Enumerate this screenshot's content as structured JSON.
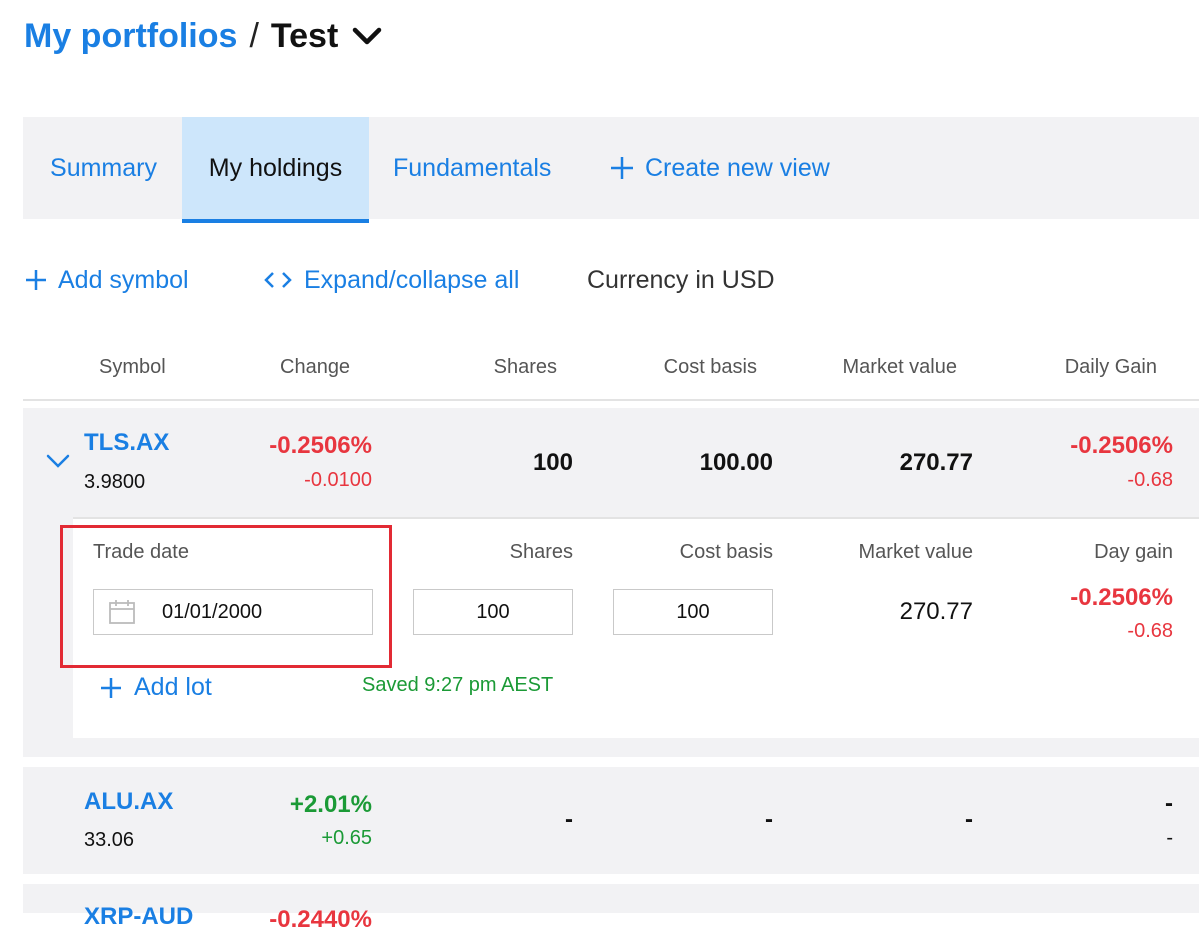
{
  "header": {
    "breadcrumb_link": "My portfolios",
    "separator": "/",
    "current": "Test"
  },
  "tabs": [
    {
      "label": "Summary"
    },
    {
      "label": "My holdings",
      "active": true
    },
    {
      "label": "Fundamentals"
    },
    {
      "label": "Create new view"
    }
  ],
  "toolbar": {
    "add_symbol": "Add symbol",
    "expand_collapse": "Expand/collapse all",
    "currency": "Currency in USD"
  },
  "columns": [
    "Symbol",
    "Change",
    "Shares",
    "Cost basis",
    "Market value",
    "Daily Gain"
  ],
  "holdings": [
    {
      "symbol": "TLS.AX",
      "price": "3.9800",
      "change_pct": "-0.2506%",
      "change_abs": "-0.0100",
      "shares": "100",
      "cost_basis": "100.00",
      "market_value": "270.77",
      "daily_gain_pct": "-0.2506%",
      "daily_gain_abs": "-0.68",
      "expanded": true
    },
    {
      "symbol": "ALU.AX",
      "price": "33.06",
      "change_pct": "+2.01%",
      "change_abs": "+0.65",
      "shares": "-",
      "cost_basis": "-",
      "market_value": "-",
      "daily_gain_pct": "-",
      "daily_gain_abs": "-"
    },
    {
      "symbol": "XRP-AUD",
      "change_pct": "-0.2440%"
    }
  ],
  "lot": {
    "headers": {
      "trade_date": "Trade date",
      "shares": "Shares",
      "cost_basis": "Cost basis",
      "market_value": "Market value",
      "day_gain": "Day gain"
    },
    "trade_date_value": "01/01/2000",
    "shares_value": "100",
    "cost_basis_value": "100",
    "market_value": "270.77",
    "day_gain_pct": "-0.2506%",
    "day_gain_abs": "-0.68",
    "add_lot": "Add lot",
    "saved_status": "Saved 9:27 pm AEST"
  },
  "colors": {
    "accent": "#1a7fe3",
    "negative": "#e8363f",
    "positive": "#1b9a36",
    "highlight": "#e22a34",
    "row_bg": "#f2f2f4",
    "active_tab_bg": "#cde6fb"
  }
}
